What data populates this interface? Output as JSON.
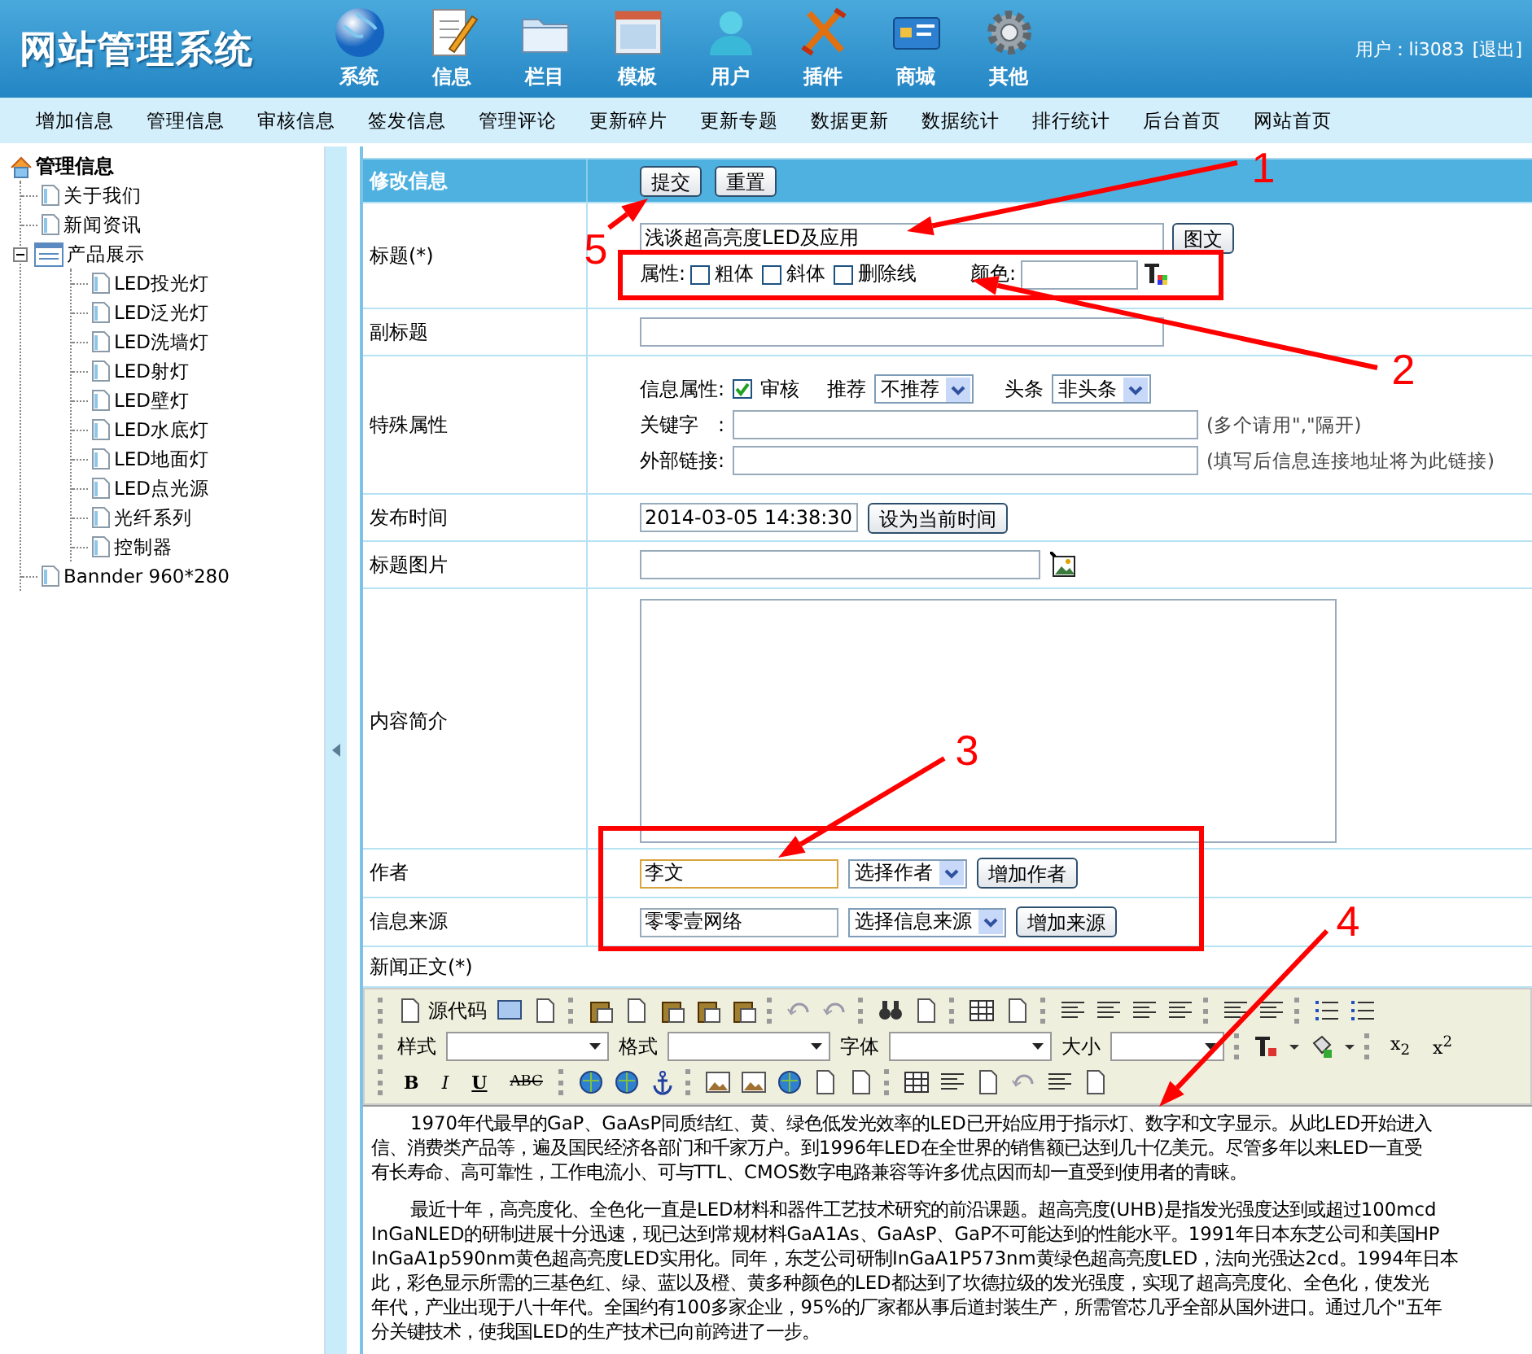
{
  "header": {
    "logo": "网站管理系统",
    "modules": [
      {
        "label": "系统"
      },
      {
        "label": "信息"
      },
      {
        "label": "栏目"
      },
      {
        "label": "模板"
      },
      {
        "label": "用户"
      },
      {
        "label": "插件"
      },
      {
        "label": "商城"
      },
      {
        "label": "其他"
      }
    ],
    "user": "用户：li3083",
    "logout": "[退出]"
  },
  "nav": [
    "增加信息",
    "管理信息",
    "审核信息",
    "签发信息",
    "管理评论",
    "更新碎片",
    "更新专题",
    "数据更新",
    "数据统计",
    "排行统计",
    "后台首页",
    "网站首页"
  ],
  "sidebar": {
    "root": "管理信息",
    "items": [
      {
        "label": "关于我们"
      },
      {
        "label": "新闻资讯"
      },
      {
        "label": "产品展示",
        "expanded": true,
        "children": [
          {
            "label": "LED投光灯"
          },
          {
            "label": "LED泛光灯"
          },
          {
            "label": "LED洗墙灯"
          },
          {
            "label": "LED射灯"
          },
          {
            "label": "LED壁灯"
          },
          {
            "label": "LED水底灯"
          },
          {
            "label": "LED地面灯"
          },
          {
            "label": "LED点光源"
          },
          {
            "label": "光纤系列"
          },
          {
            "label": "控制器"
          }
        ]
      },
      {
        "label": "Bannder 960*280"
      }
    ]
  },
  "form": {
    "heading": "修改信息",
    "submit": "提交",
    "reset": "重置",
    "title": {
      "label": "标题(*)",
      "value": "浅谈超高亮度LED及应用",
      "button": "图文",
      "attr_label": "属性:",
      "styles": [
        {
          "label": "粗体",
          "checked": false
        },
        {
          "label": "斜体",
          "checked": false
        },
        {
          "label": "删除线",
          "checked": false
        }
      ],
      "color_label": "颜色:"
    },
    "subtitle": {
      "label": "副标题"
    },
    "special": {
      "label": "特殊属性",
      "info_label": "信息属性:",
      "review": {
        "label": "审核",
        "checked": true
      },
      "recommend_label": "推荐",
      "recommend": "不推荐",
      "headline_label": "头条",
      "headline": "非头条",
      "keyword_label": "关键字　:",
      "keyword_hint": "(多个请用\",\"隔开)",
      "link_label": "外部链接:",
      "link_hint": "(填写后信息连接地址将为此链接)"
    },
    "publish": {
      "label": "发布时间",
      "value": "2014-03-05 14:38:30",
      "button": "设为当前时间"
    },
    "image": {
      "label": "标题图片"
    },
    "summary": {
      "label": "内容简介"
    },
    "author": {
      "label": "作者",
      "value": "李文",
      "focused": true,
      "select": "选择作者",
      "button": "增加作者"
    },
    "source": {
      "label": "信息来源",
      "value": "零零壹网络",
      "focused": false,
      "select": "选择信息来源",
      "button": "增加来源"
    },
    "body_label": "新闻正文(*)"
  },
  "editor": {
    "source_label": "源代码",
    "selects": [
      {
        "label": "样式"
      },
      {
        "label": "格式"
      },
      {
        "label": "字体"
      },
      {
        "label": "大小"
      }
    ],
    "subscript": "x$_{2}$",
    "superscript": "x$^{2}$",
    "format_buttons": [
      "B",
      "I",
      "U",
      "ABC"
    ],
    "paragraphs": [
      {
        "lines": [
          "1970年代最早的GaP、GaAsP同质结红、黄、绿色低发光效率的LED已开始应用于指示灯、数字和文字显示。从此LED开始进入",
          "信、消费类产品等，遍及国民经济各部门和千家万户。到1996年LED在全世界的销售额已达到几十亿美元。尽管多年以来LED一直受",
          "有长寿命、高可靠性，工作电流小、可与TTL、CMOS数字电路兼容等许多优点因而却一直受到使用者的青睐。"
        ]
      },
      {
        "lines": [
          "最近十年，高亮度化、全色化一直是LED材料和器件工艺技术研究的前沿课题。超高亮度(UHB)是指发光强度达到或超过100mcd",
          "InGaNLED的研制进展十分迅速，现已达到常规材料GaA1As、GaAsP、GaP不可能达到的性能水平。1991年日本东芝公司和美国HP",
          "InGaA1p590nm黄色超高亮度LED实用化。同年，东芝公司研制InGaA1P573nm黄绿色超高亮度LED，法向光强达2cd。1994年日本",
          "此，彩色显示所需的三基色红、绿、蓝以及橙、黄多种颜色的LED都达到了坎德拉级的发光强度，实现了超高亮度化、全色化，使发光",
          "年代，产业出现于八十年代。全国约有100多家企业，95%的厂家都从事后道封装生产，所需管芯几乎全部从国外进口。通过几个\"五年",
          "分关键技术，使我国LED的生产技术已向前跨进了一步。"
        ]
      }
    ]
  },
  "annotations": [
    {
      "label": "1"
    },
    {
      "label": "2"
    },
    {
      "label": "3"
    },
    {
      "label": "4"
    },
    {
      "label": "5"
    }
  ]
}
